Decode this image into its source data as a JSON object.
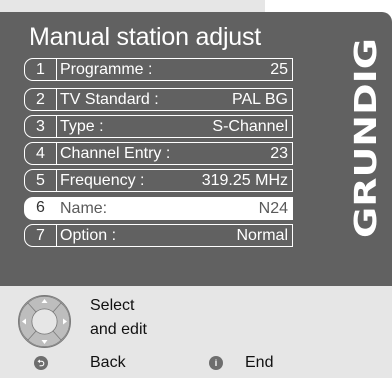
{
  "menu": {
    "title": "Manual station adjust",
    "rows": [
      {
        "num": "1",
        "label": "Programme :",
        "value": "25"
      },
      {
        "num": "2",
        "label": "TV Standard :",
        "value": "PAL BG"
      },
      {
        "num": "3",
        "label": "Type :",
        "value": "S-Channel"
      },
      {
        "num": "4",
        "label": "Channel Entry :",
        "value": "23"
      },
      {
        "num": "5",
        "label": "Frequency :",
        "value": "319.25 MHz"
      },
      {
        "num": "6",
        "label": "Name:",
        "value": "N24"
      },
      {
        "num": "7",
        "label": "Option :",
        "value": "Normal"
      }
    ],
    "selected_index": 5
  },
  "brand": {
    "name": "GRUNDIG"
  },
  "help": {
    "select_line1": "Select",
    "select_line2": "and edit",
    "back_label": "Back",
    "end_label": "End",
    "back_icon_glyph": "⮌",
    "end_icon_glyph": "i"
  },
  "colors": {
    "panel": "#616161",
    "help_bg": "#e6e6e6",
    "text_light": "#ffffff",
    "selected_text": "#5a5a5a"
  }
}
